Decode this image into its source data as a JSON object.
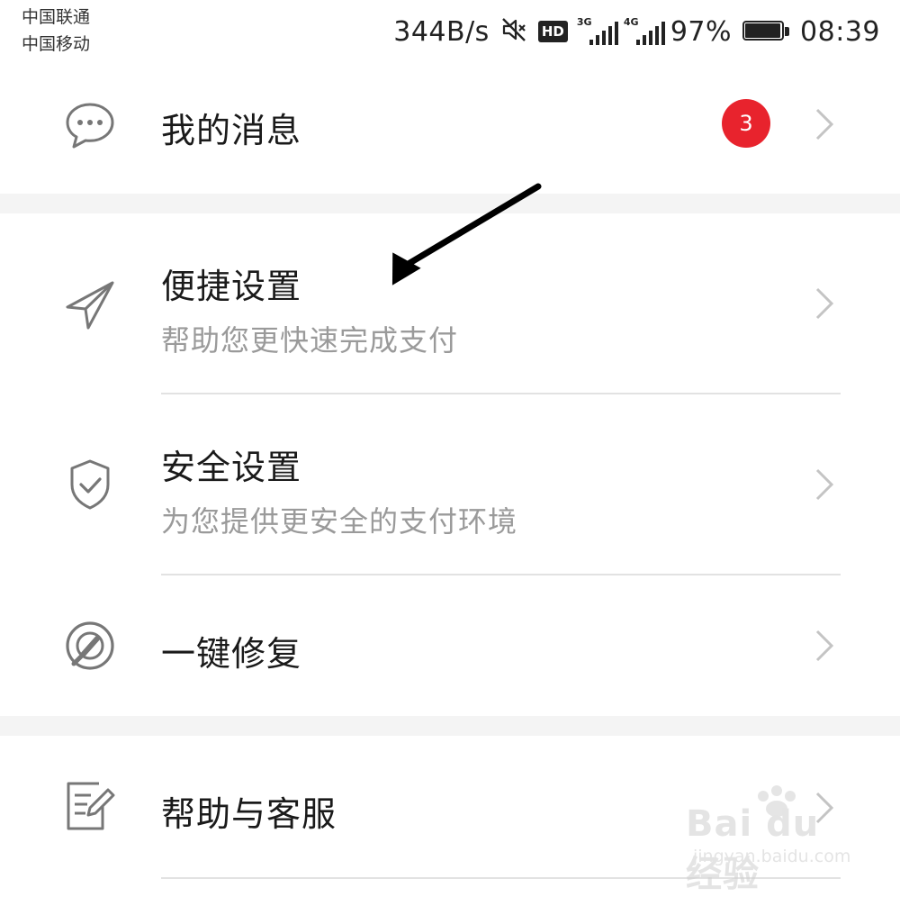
{
  "status_bar": {
    "carrier_1": "中国联通",
    "carrier_2": "中国移动",
    "net_speed": "344B/s",
    "hd_label": "HD",
    "sim1_network": "3G",
    "sim2_network": "4G",
    "battery_percent": "97%",
    "battery_level": 0.97,
    "time": "08:39"
  },
  "menu": {
    "messages": {
      "title": "我的消息",
      "badge_count": "3",
      "icon": "chat-bubble-icon"
    },
    "quick_settings": {
      "title": "便捷设置",
      "subtitle": "帮助您更快速完成支付",
      "icon": "paper-plane-icon"
    },
    "security_settings": {
      "title": "安全设置",
      "subtitle": "为您提供更安全的支付环境",
      "icon": "shield-check-icon"
    },
    "one_click_repair": {
      "title": "一键修复",
      "icon": "repair-wrench-icon"
    },
    "help_service": {
      "title": "帮助与客服",
      "icon": "edit-document-icon"
    }
  },
  "watermark": {
    "main": "Bai du 经验",
    "sub": "jingyan.baidu.com"
  },
  "colors": {
    "badge": "#e8232d",
    "section_gap": "#f4f4f4",
    "subtitle": "#9a9a9a"
  }
}
